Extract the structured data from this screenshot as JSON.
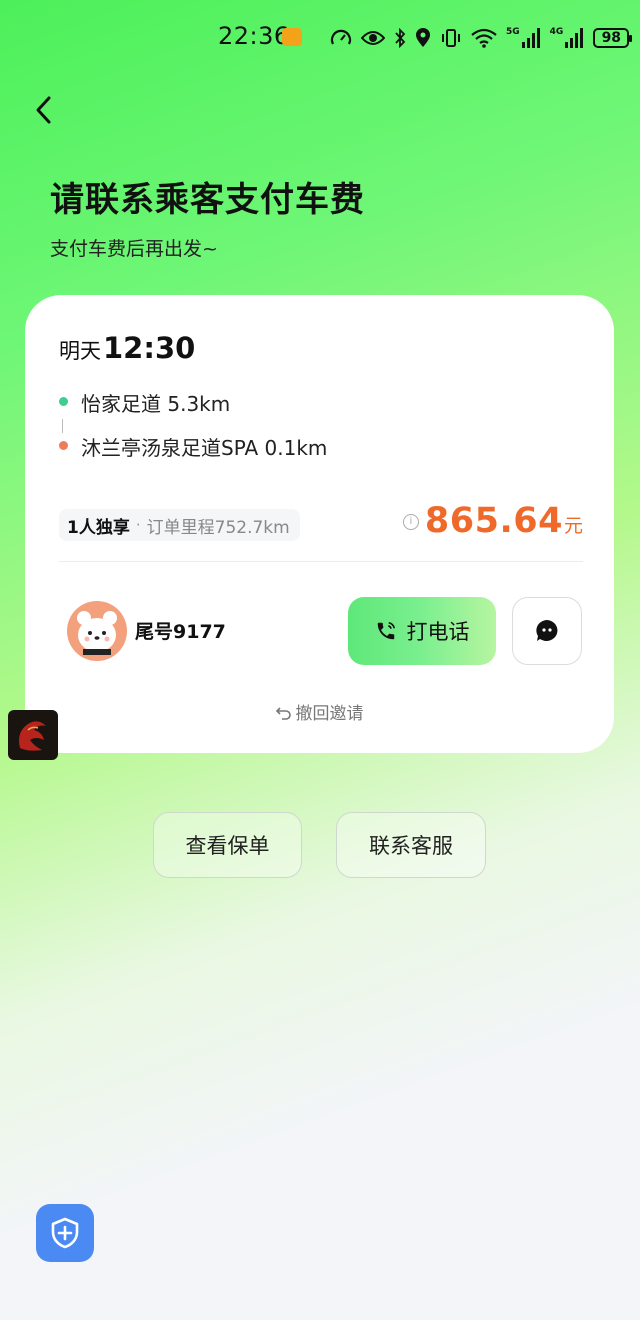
{
  "status_bar": {
    "time": "22:36",
    "battery": "98",
    "signal_1_label": "5G",
    "signal_2_label": "4G"
  },
  "header": {
    "title": "请联系乘客支付车费",
    "subtitle": "支付车费后再出发~"
  },
  "trip": {
    "day": "明天",
    "time": "12:30",
    "pickup": "怡家足道 5.3km",
    "dropoff": "沐兰亭汤泉足道SPA 0.1km",
    "pickup_color": "#3ccf8e",
    "dropoff_color": "#ef7b5a",
    "ride_type": "1人独享",
    "separator": "·",
    "order_distance": "订单里程752.7km",
    "fare_amount": "865.64",
    "fare_unit": "元",
    "accent_color": "#ef6a2a"
  },
  "passenger": {
    "tail_number": "尾号9177",
    "call_label": "打电话",
    "withdraw_label": "撤回邀请"
  },
  "actions": {
    "view_policy": "查看保单",
    "contact_support": "联系客服"
  },
  "icons": {
    "back": "chevron-left-icon",
    "call": "phone-icon",
    "chat": "chat-bubble-icon",
    "withdraw": "undo-icon",
    "safety": "shield-plus-icon",
    "info": "info-icon"
  }
}
